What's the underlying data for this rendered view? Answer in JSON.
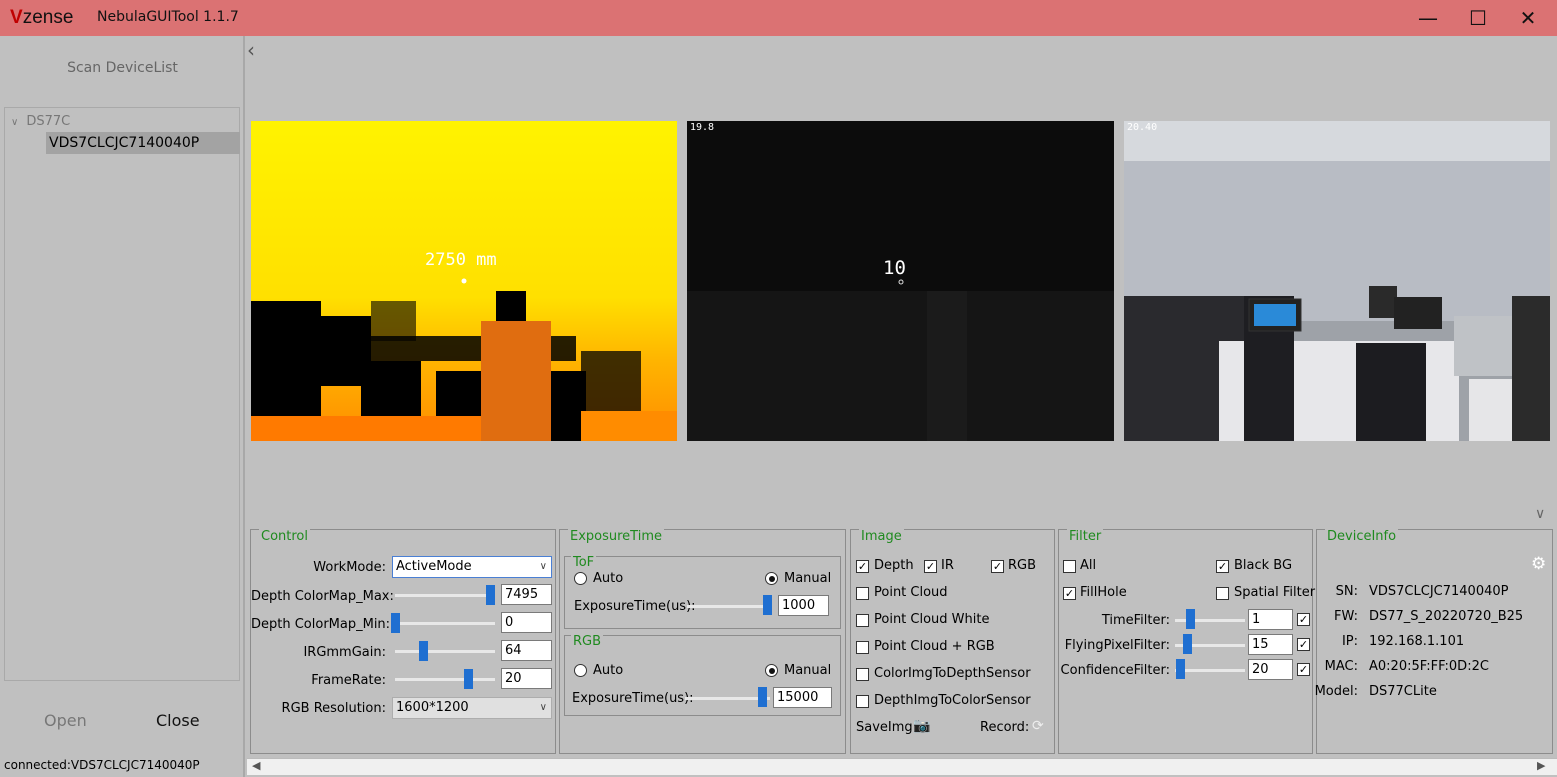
{
  "window": {
    "logo_v": "V",
    "logo_rest": "zense",
    "title": "NebulaGUITool 1.1.7",
    "minimize": "—",
    "maximize": "☐",
    "close": "✕"
  },
  "left": {
    "scan": "Scan DeviceList",
    "tree_root": "DS77C",
    "tree_child": "VDS7CLCJC7140040P",
    "open": "Open",
    "close": "Close",
    "status": "connected:VDS7CLCJC7140040P"
  },
  "views": {
    "depth": {
      "fps": "",
      "value": "2750 mm"
    },
    "ir": {
      "fps": "19.8",
      "value": "10"
    },
    "rgb": {
      "fps": "20.40"
    }
  },
  "control": {
    "title": "Control",
    "workmode_label": "WorkMode:",
    "workmode_value": "ActiveMode",
    "depth_max_label": "Depth ColorMap_Max:",
    "depth_max": "7495",
    "depth_min_label": "Depth ColorMap_Min:",
    "depth_min": "0",
    "irgain_label": "IRGmmGain:",
    "irgain": "64",
    "framerate_label": "FrameRate:",
    "framerate": "20",
    "rgbres_label": "RGB Resolution:",
    "rgbres_value": "1600*1200",
    "depth_max_frac": 0.95,
    "depth_min_frac": 0.0,
    "irgain_frac": 0.28,
    "framerate_frac": 0.73
  },
  "exposure": {
    "title": "ExposureTime",
    "tof_title": "ToF",
    "auto": "Auto",
    "manual": "Manual",
    "tof_label": "ExposureTime(us):",
    "tof_value": "1000",
    "rgb_title": "RGB",
    "rgb_label": "ExposureTime(us):",
    "rgb_value": "15000"
  },
  "image": {
    "title": "Image",
    "depth": "Depth",
    "ir": "IR",
    "rgb": "RGB",
    "point_cloud": "Point Cloud",
    "point_cloud_white": "Point Cloud White",
    "point_cloud_rgb": "Point Cloud + RGB",
    "color_to_depth": "ColorImgToDepthSensor",
    "depth_to_color": "DepthImgToColorSensor",
    "saveimg": "SaveImg:",
    "record": "Record:"
  },
  "filter": {
    "title": "Filter",
    "all": "All",
    "black_bg": "Black BG",
    "fillhole": "FillHole",
    "spatial": "Spatial Filter",
    "time_label": "TimeFilter:",
    "time_value": "1",
    "flying_label": "FlyingPixelFilter:",
    "flying_value": "15",
    "confidence_label": "ConfidenceFilter:",
    "confidence_value": "20"
  },
  "deviceinfo": {
    "title": "DeviceInfo",
    "sn_k": "SN:",
    "sn": "VDS7CLCJC7140040P",
    "fw_k": "FW:",
    "fw": "DS77_S_20220720_B25",
    "ip_k": "IP:",
    "ip": "192.168.1.101",
    "mac_k": "MAC:",
    "mac": "A0:20:5F:FF:0D:2C",
    "model_k": "Model:",
    "model": "DS77CLite"
  },
  "colors": {
    "titlebar": "#db7273",
    "accent_green": "#1f8a1f",
    "slider_blue": "#1f6fd1"
  }
}
